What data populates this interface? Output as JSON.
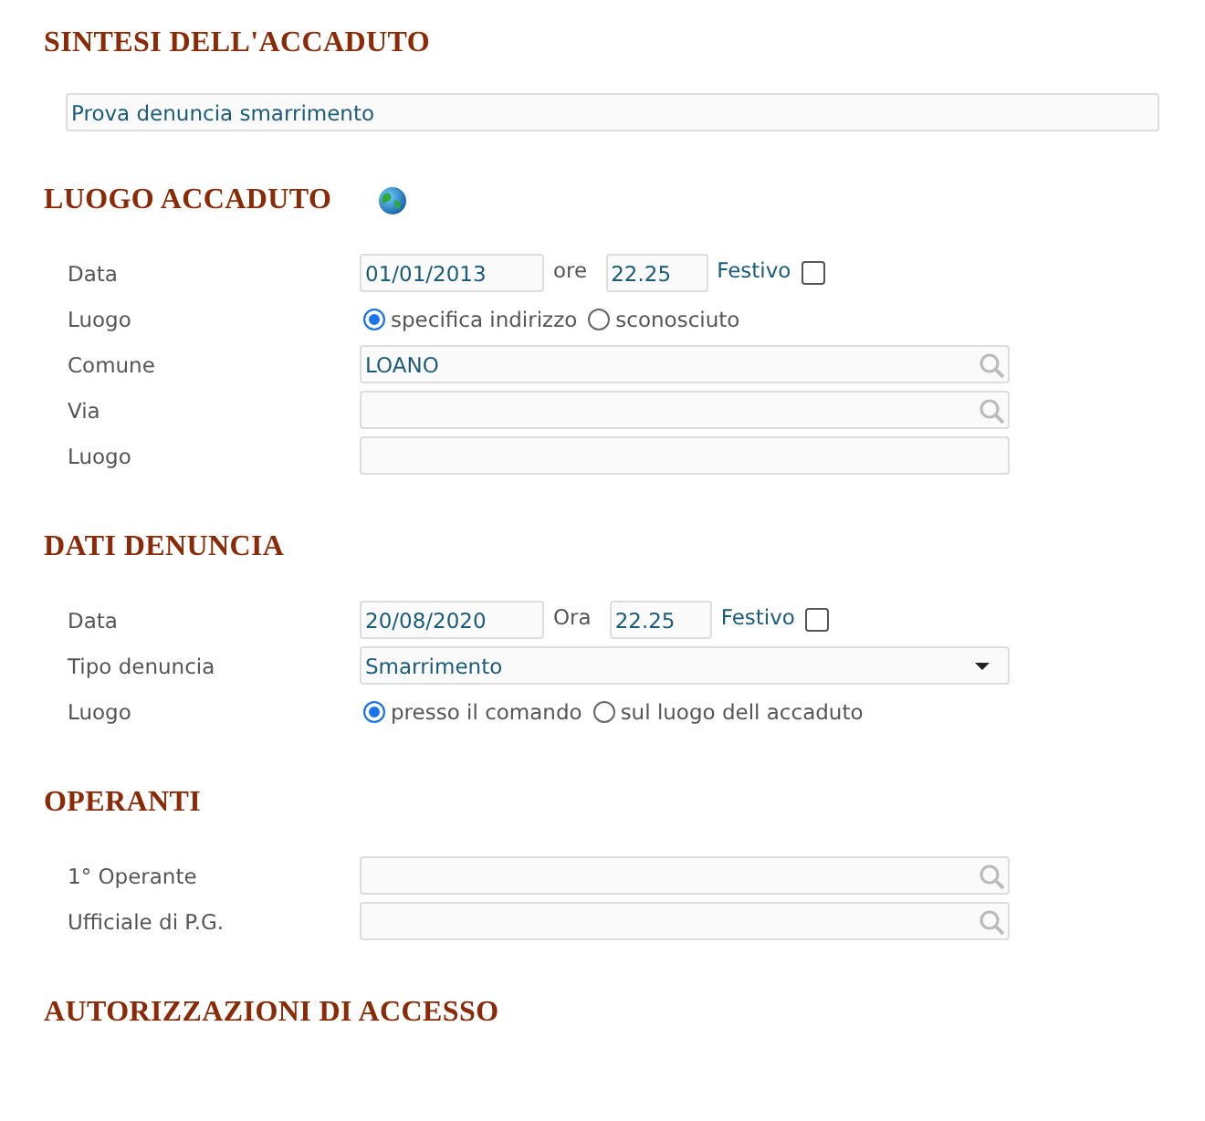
{
  "sections": [
    {
      "title": "SINTESI DELL'ACCADUTO",
      "summary": {
        "value": "Prova denuncia smarrimento"
      }
    },
    {
      "title": "LUOGO ACCADUTO",
      "rows": [
        {
          "label": "Data",
          "kind": "datetime",
          "date": "01/01/2013",
          "time_label": "ore",
          "time": "22.25",
          "holiday_label": "Festivo",
          "holiday_checked": false
        },
        {
          "label": "Luogo",
          "kind": "radio",
          "options": [
            {
              "label": "specifica indirizzo",
              "selected": true
            },
            {
              "label": "sconosciuto",
              "selected": false
            }
          ]
        },
        {
          "label": "Comune",
          "kind": "lookup",
          "value": "LOANO"
        },
        {
          "label": "Via",
          "kind": "lookup"
        },
        {
          "label": "Luogo",
          "kind": "text"
        }
      ]
    },
    {
      "title": "DATI DENUNCIA",
      "rows": [
        {
          "label": "Data",
          "kind": "datetime",
          "date": "20/08/2020",
          "time_label": "Ora",
          "time": "22.25",
          "holiday_label": "Festivo",
          "holiday_checked": false
        },
        {
          "label": "Tipo denuncia",
          "kind": "select",
          "value": "Smarrimento"
        },
        {
          "label": "Luogo",
          "kind": "radio",
          "options": [
            {
              "label": "presso il comando",
              "selected": true
            },
            {
              "label": "sul luogo dell accaduto",
              "selected": false
            }
          ]
        }
      ]
    },
    {
      "title": "OPERANTI",
      "rows": [
        {
          "label": "1° Operante",
          "kind": "lookup"
        },
        {
          "label": "Ufficiale di P.G.",
          "kind": "lookup"
        }
      ]
    },
    {
      "title": "AUTORIZZAZIONI DI ACCESSO"
    }
  ]
}
